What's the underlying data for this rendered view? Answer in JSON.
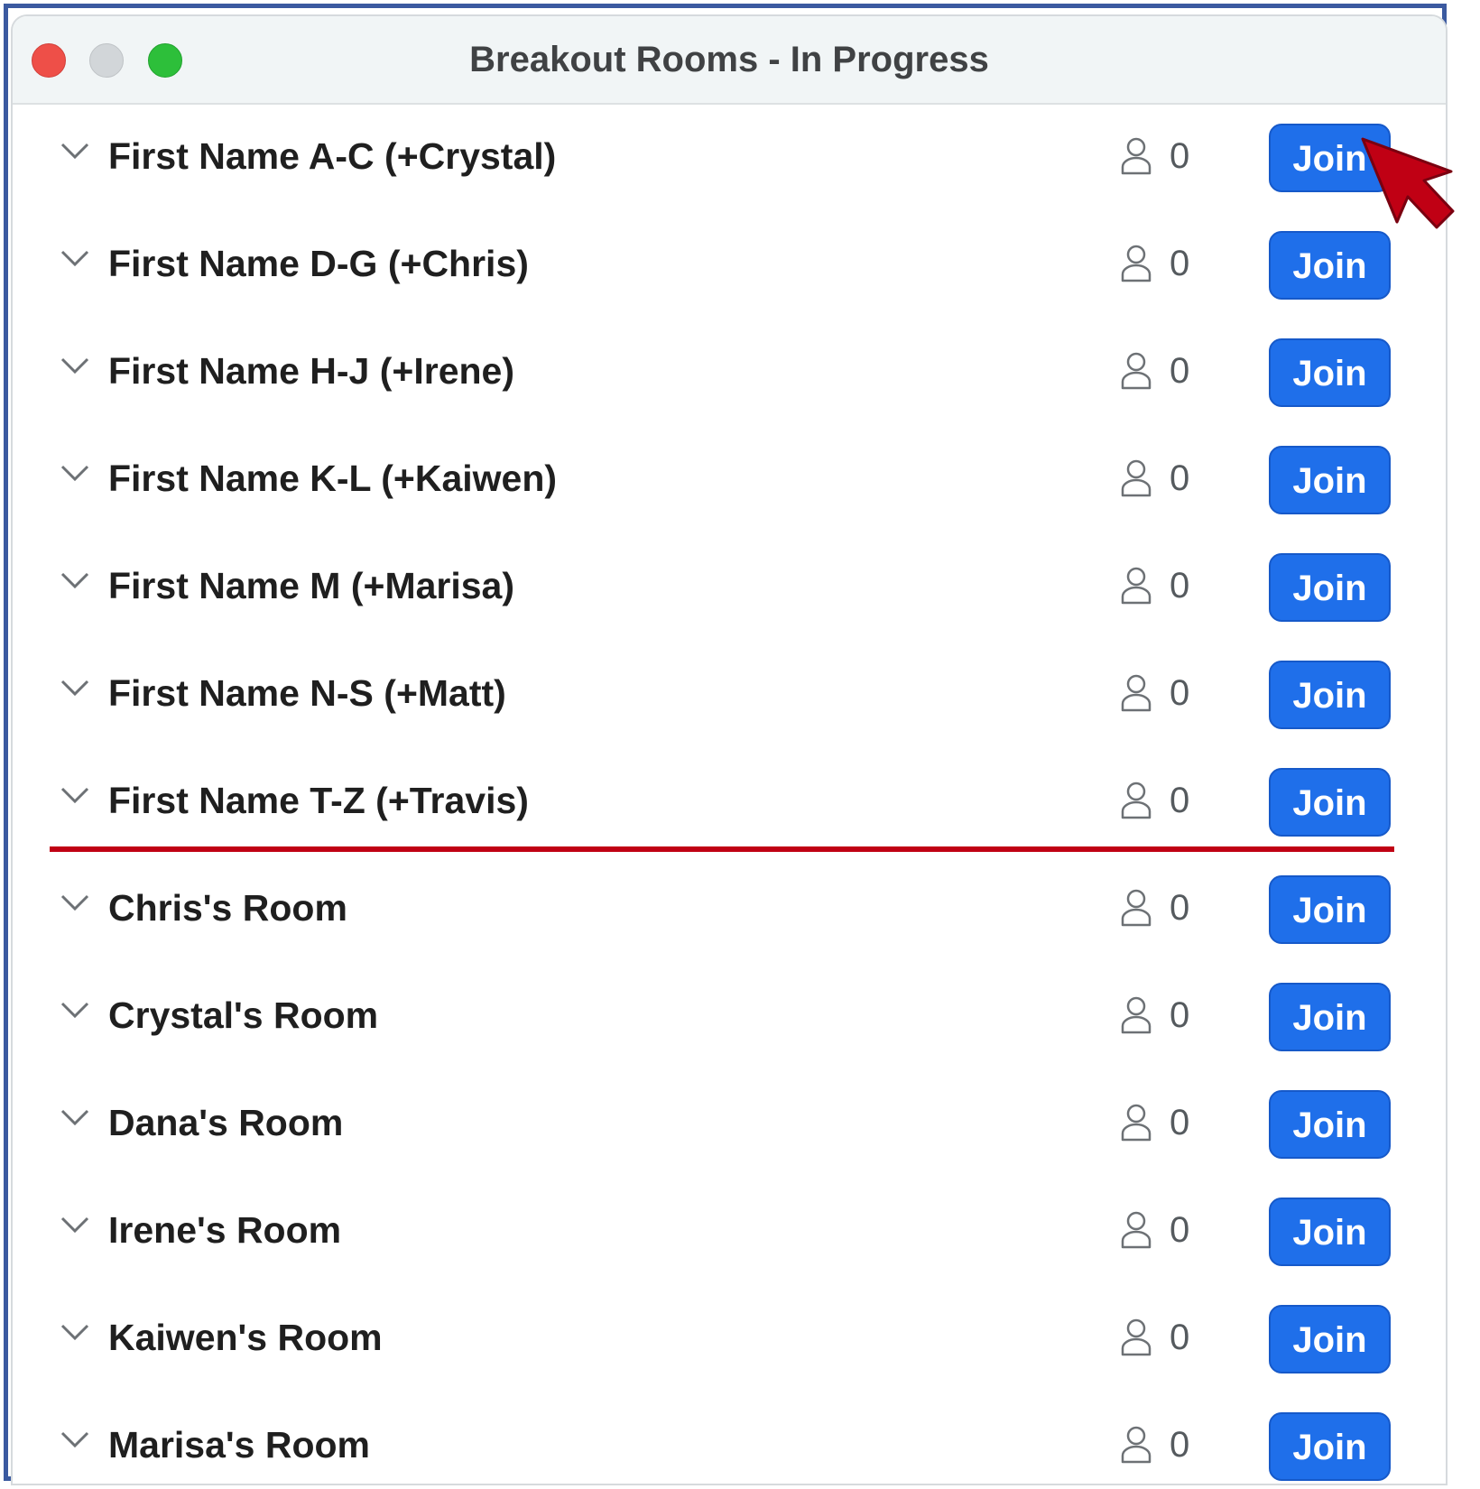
{
  "window": {
    "title": "Breakout Rooms - In Progress"
  },
  "annotation": {
    "divider_color": "#c00014",
    "arrow_color": "#c00014"
  },
  "accent": "#1f6fea",
  "icons": {
    "chevron": "chevron-down-icon",
    "participants": "person-icon"
  },
  "rooms": [
    {
      "name": "First Name A-C (+Crystal)",
      "count": "0",
      "join_label": "Join"
    },
    {
      "name": "First Name D-G (+Chris)",
      "count": "0",
      "join_label": "Join"
    },
    {
      "name": "First Name H-J (+Irene)",
      "count": "0",
      "join_label": "Join"
    },
    {
      "name": "First Name K-L (+Kaiwen)",
      "count": "0",
      "join_label": "Join"
    },
    {
      "name": "First Name M (+Marisa)",
      "count": "0",
      "join_label": "Join"
    },
    {
      "name": "First Name N-S (+Matt)",
      "count": "0",
      "join_label": "Join"
    },
    {
      "name": "First Name T-Z (+Travis)",
      "count": "0",
      "join_label": "Join"
    },
    {
      "name": "Chris's Room",
      "count": "0",
      "join_label": "Join"
    },
    {
      "name": "Crystal's Room",
      "count": "0",
      "join_label": "Join"
    },
    {
      "name": "Dana's Room",
      "count": "0",
      "join_label": "Join"
    },
    {
      "name": "Irene's Room",
      "count": "0",
      "join_label": "Join"
    },
    {
      "name": "Kaiwen's Room",
      "count": "0",
      "join_label": "Join"
    },
    {
      "name": "Marisa's Room",
      "count": "0",
      "join_label": "Join"
    }
  ]
}
